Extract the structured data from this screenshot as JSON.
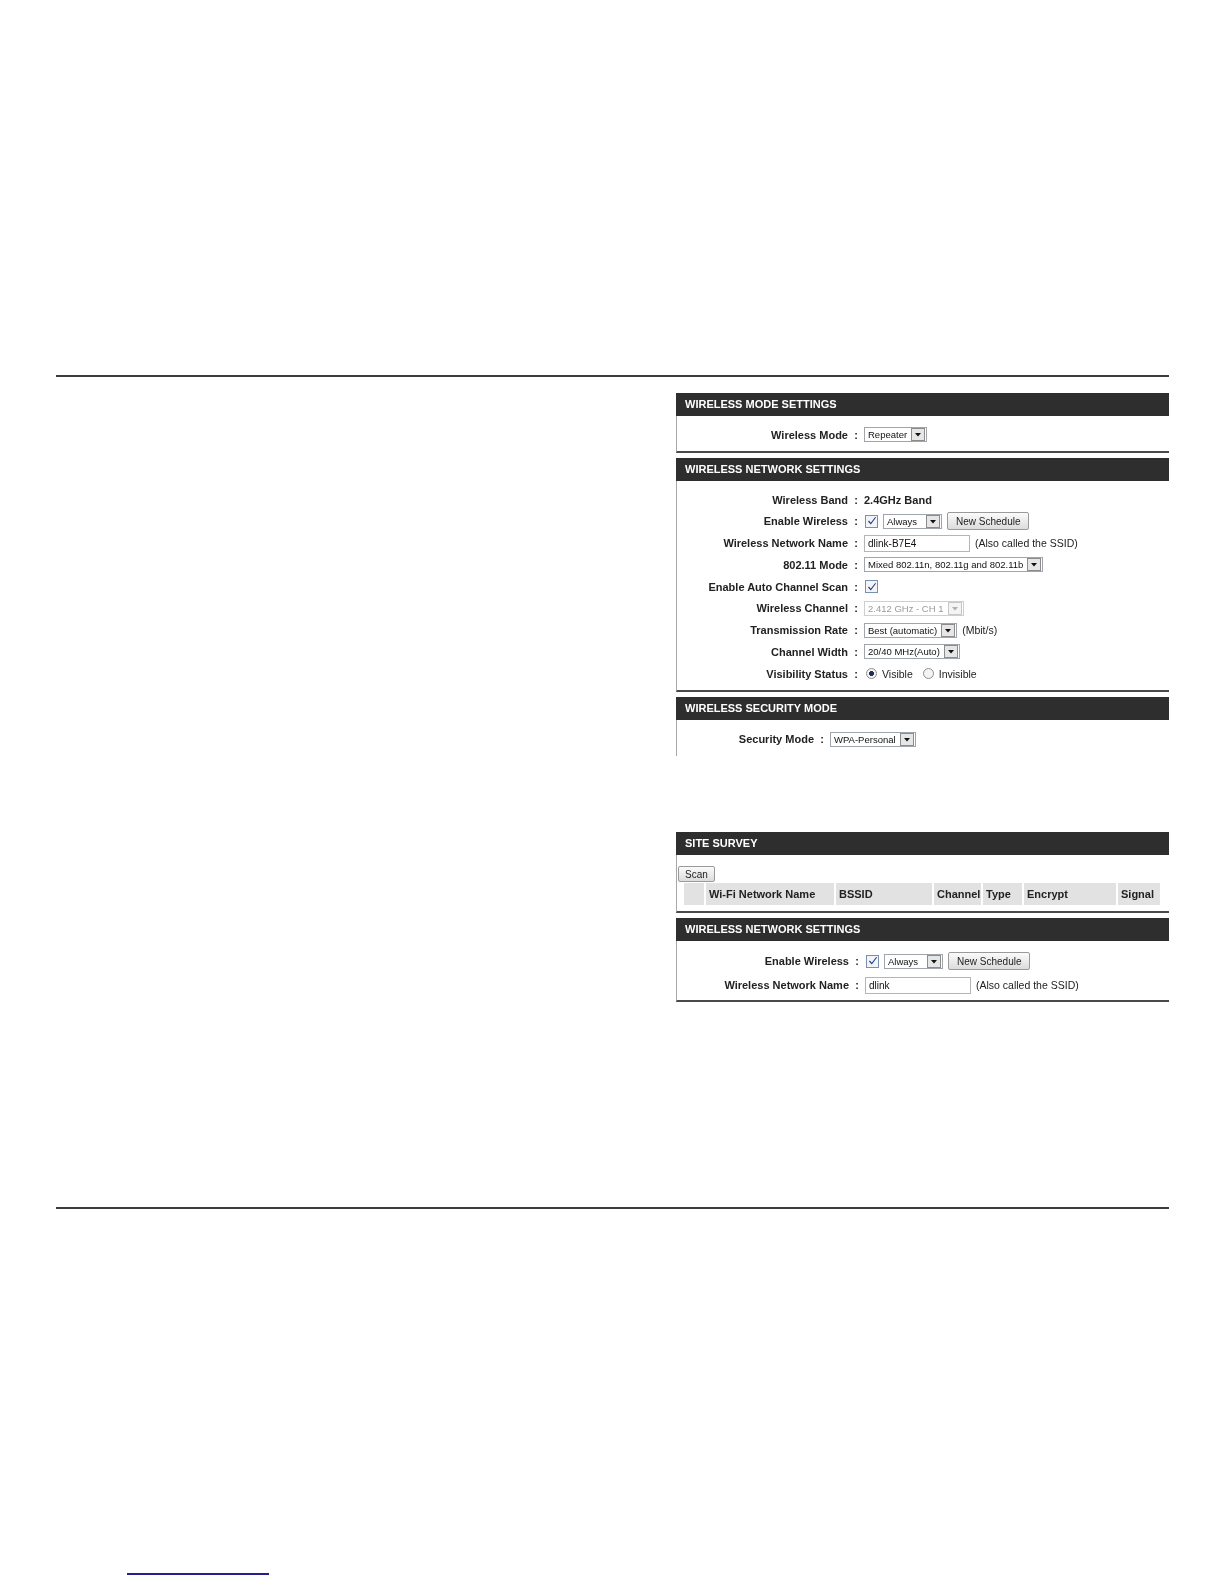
{
  "screenshots": [
    {
      "panels": [
        {
          "title": "WIRELESS MODE SETTINGS",
          "kind": "form",
          "rows": [
            {
              "label": "Wireless Mode",
              "colon": ":",
              "controls": [
                {
                  "kind": "select",
                  "value": "Repeater",
                  "disabled": false
                }
              ]
            }
          ]
        },
        {
          "title": "WIRELESS NETWORK SETTINGS",
          "kind": "form",
          "rows": [
            {
              "label": "Wireless Band",
              "colon": ":",
              "controls": [
                {
                  "kind": "text",
                  "value": "2.4GHz Band"
                }
              ]
            },
            {
              "label": "Enable Wireless",
              "colon": ":",
              "controls": [
                {
                  "kind": "checkbox",
                  "checked": true
                },
                {
                  "kind": "select",
                  "value": "Always",
                  "disabled": false
                },
                {
                  "kind": "button",
                  "label": "New Schedule"
                }
              ]
            },
            {
              "label": "Wireless Network Name",
              "colon": ":",
              "controls": [
                {
                  "kind": "input",
                  "value": "dlink-B7E4"
                },
                {
                  "kind": "note",
                  "text": "(Also called the SSID)"
                }
              ]
            },
            {
              "label": "802.11 Mode",
              "colon": ":",
              "controls": [
                {
                  "kind": "select",
                  "value": "Mixed 802.11n, 802.11g and 802.11b",
                  "disabled": false
                }
              ]
            },
            {
              "label": "Enable Auto Channel Scan",
              "colon": ":",
              "controls": [
                {
                  "kind": "checkbox",
                  "checked": true
                }
              ]
            },
            {
              "label": "Wireless Channel",
              "colon": ":",
              "controls": [
                {
                  "kind": "select",
                  "value": "2.412 GHz - CH 1",
                  "disabled": true
                }
              ]
            },
            {
              "label": "Transmission Rate",
              "colon": ":",
              "controls": [
                {
                  "kind": "select",
                  "value": "Best (automatic)",
                  "disabled": false
                },
                {
                  "kind": "note",
                  "text": "(Mbit/s)"
                }
              ]
            },
            {
              "label": "Channel Width",
              "colon": ":",
              "controls": [
                {
                  "kind": "select",
                  "value": "20/40 MHz(Auto)",
                  "disabled": false
                }
              ]
            },
            {
              "label": "Visibility Status",
              "colon": ":",
              "controls": [
                {
                  "kind": "radio",
                  "label": "Visible",
                  "selected": true
                },
                {
                  "kind": "radio",
                  "label": "Invisible",
                  "selected": false
                }
              ]
            }
          ]
        },
        {
          "title": "WIRELESS SECURITY MODE",
          "kind": "form",
          "rows": [
            {
              "label": "Security Mode",
              "colon": ":",
              "controls": [
                {
                  "kind": "select",
                  "value": "WPA-Personal",
                  "disabled": false
                }
              ]
            }
          ]
        }
      ]
    },
    {
      "panels": [
        {
          "title": "SITE SURVEY",
          "kind": "survey",
          "button": "Scan",
          "columns": [
            "Wi-Fi Network Name",
            "BSSID",
            "Channel",
            "Type",
            "Encrypt",
            "Signal"
          ]
        },
        {
          "title": "WIRELESS NETWORK SETTINGS",
          "kind": "form",
          "rows": [
            {
              "label": "Enable Wireless",
              "colon": ":",
              "controls": [
                {
                  "kind": "checkbox",
                  "checked": true
                },
                {
                  "kind": "select",
                  "value": "Always",
                  "disabled": false
                },
                {
                  "kind": "button",
                  "label": "New Schedule"
                }
              ]
            },
            {
              "label": "Wireless Network Name",
              "colon": ":",
              "controls": [
                {
                  "kind": "input",
                  "value": "dlink"
                },
                {
                  "kind": "note",
                  "text": "(Also called the SSID)"
                }
              ]
            }
          ]
        }
      ]
    }
  ]
}
